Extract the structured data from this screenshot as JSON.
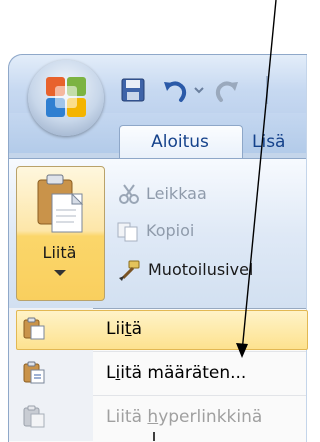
{
  "tabs": [
    {
      "label": "Aloitus",
      "selected": true
    },
    {
      "label": "Lisä",
      "selected": false
    }
  ],
  "clipboard": {
    "paste_label": "Liitä",
    "cut_label": "Leikkaa",
    "copy_label": "Kopioi",
    "format_painter_label": "Muotoilusivel"
  },
  "paste_menu": {
    "items": [
      {
        "pre": "Lii",
        "accel": "t",
        "post": "ä",
        "enabled": true,
        "highlighted": true
      },
      {
        "pre": "L",
        "accel": "i",
        "post": "itä määräten...",
        "enabled": true,
        "highlighted": false
      },
      {
        "pre": "Liitä ",
        "accel": "h",
        "post": "yperlinkkinä",
        "enabled": false,
        "highlighted": false
      }
    ]
  },
  "icons": {
    "office_button": "office-logo-icon",
    "save": "save-icon",
    "undo": "undo-icon",
    "redo": "redo-icon",
    "paste": "clipboard-paste-icon",
    "cut": "scissors-icon",
    "copy": "copy-icon",
    "format_painter": "paintbrush-icon"
  },
  "colors": {
    "tab_text": "#15428b",
    "menu_highlight": "#fde28f",
    "disabled_text": "#a0a0a0",
    "annotation_line": "#000000"
  }
}
